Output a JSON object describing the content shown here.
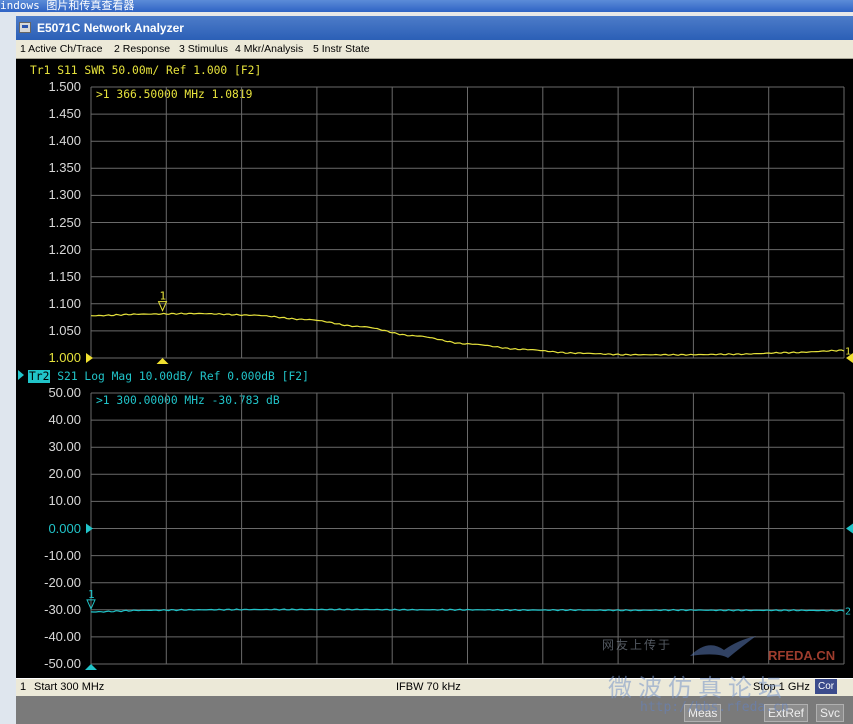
{
  "outer_title": "indows 图片和传真查看器",
  "window_title": "E5071C Network Analyzer",
  "menu": [
    {
      "label": "1 Active Ch/Trace"
    },
    {
      "label": "2 Response"
    },
    {
      "label": "3 Stimulus"
    },
    {
      "label": "4 Mkr/Analysis"
    },
    {
      "label": "5 Instr State"
    }
  ],
  "colors": {
    "trace1": "#e6e23c",
    "trace2": "#21c4c9",
    "grid": "#6a6a6a",
    "marker": "#f0e030"
  },
  "trace1": {
    "header": "Tr1 S11 SWR 50.00m/ Ref 1.000 [F2]",
    "marker_readout": ">1  366.50000 MHz  1.0819",
    "marker_label": "1",
    "end_label": "1",
    "y_ticks": [
      "1.500",
      "1.450",
      "1.400",
      "1.350",
      "1.300",
      "1.250",
      "1.200",
      "1.150",
      "1.100",
      "1.050",
      "1.000"
    ],
    "ref_value": 1.0,
    "ylim": [
      1.0,
      1.5
    ],
    "marker": {
      "freq_mhz": 366.5,
      "value": 1.0819
    }
  },
  "trace2": {
    "badge": "Tr2",
    "header": "S21 Log Mag 10.00dB/ Ref 0.000dB [F2]",
    "marker_readout": ">1  300.00000 MHz -30.783 dB",
    "marker_label": "1",
    "end_label": "2",
    "y_ticks": [
      "50.00",
      "40.00",
      "30.00",
      "20.00",
      "10.00",
      "0.000",
      "-10.00",
      "-20.00",
      "-30.00",
      "-40.00",
      "-50.00"
    ],
    "ref_value": 0,
    "ylim": [
      -50,
      50
    ],
    "marker": {
      "freq_mhz": 300.0,
      "value": -30.783
    }
  },
  "status": {
    "channel": "1",
    "start": "Start 300 MHz",
    "ifbw": "IFBW 70 kHz",
    "stop": "Stop 1 GHz",
    "cor": "Cor"
  },
  "bottom_buttons": [
    "Meas",
    "ExtRef",
    "Svc"
  ],
  "watermark": {
    "small": "网友上传于",
    "brand": "RFEDA.CN",
    "big": "微波仿真论坛",
    "url": "http://bbs.rfeda.cn"
  },
  "chart_data": [
    {
      "type": "line",
      "title": "Tr1 S11 SWR 50.00m/ Ref 1.000 [F2]",
      "x": [
        300,
        350,
        400,
        450,
        500,
        550,
        600,
        650,
        700,
        750,
        800,
        850,
        900,
        950,
        1000
      ],
      "series": [
        {
          "name": "Tr1 S11 SWR",
          "values": [
            1.078,
            1.081,
            1.082,
            1.079,
            1.071,
            1.058,
            1.041,
            1.026,
            1.016,
            1.009,
            1.006,
            1.006,
            1.007,
            1.01,
            1.014
          ]
        }
      ],
      "xlim": [
        300,
        1000
      ],
      "ylim": [
        1.0,
        1.5
      ],
      "grid": true
    },
    {
      "type": "line",
      "title": "Tr2 S21 Log Mag 10.00dB/ Ref 0.000dB [F2]",
      "x": [
        300,
        350,
        400,
        450,
        500,
        550,
        600,
        650,
        700,
        750,
        800,
        850,
        900,
        950,
        1000
      ],
      "series": [
        {
          "name": "Tr2 S21 Log Mag",
          "values": [
            -30.78,
            -30.2,
            -30.0,
            -29.9,
            -29.9,
            -29.9,
            -30.0,
            -30.0,
            -30.1,
            -30.1,
            -30.2,
            -30.1,
            -30.2,
            -30.2,
            -30.3
          ]
        }
      ],
      "xlim": [
        300,
        1000
      ],
      "ylim": [
        -50,
        50
      ],
      "grid": true
    }
  ]
}
